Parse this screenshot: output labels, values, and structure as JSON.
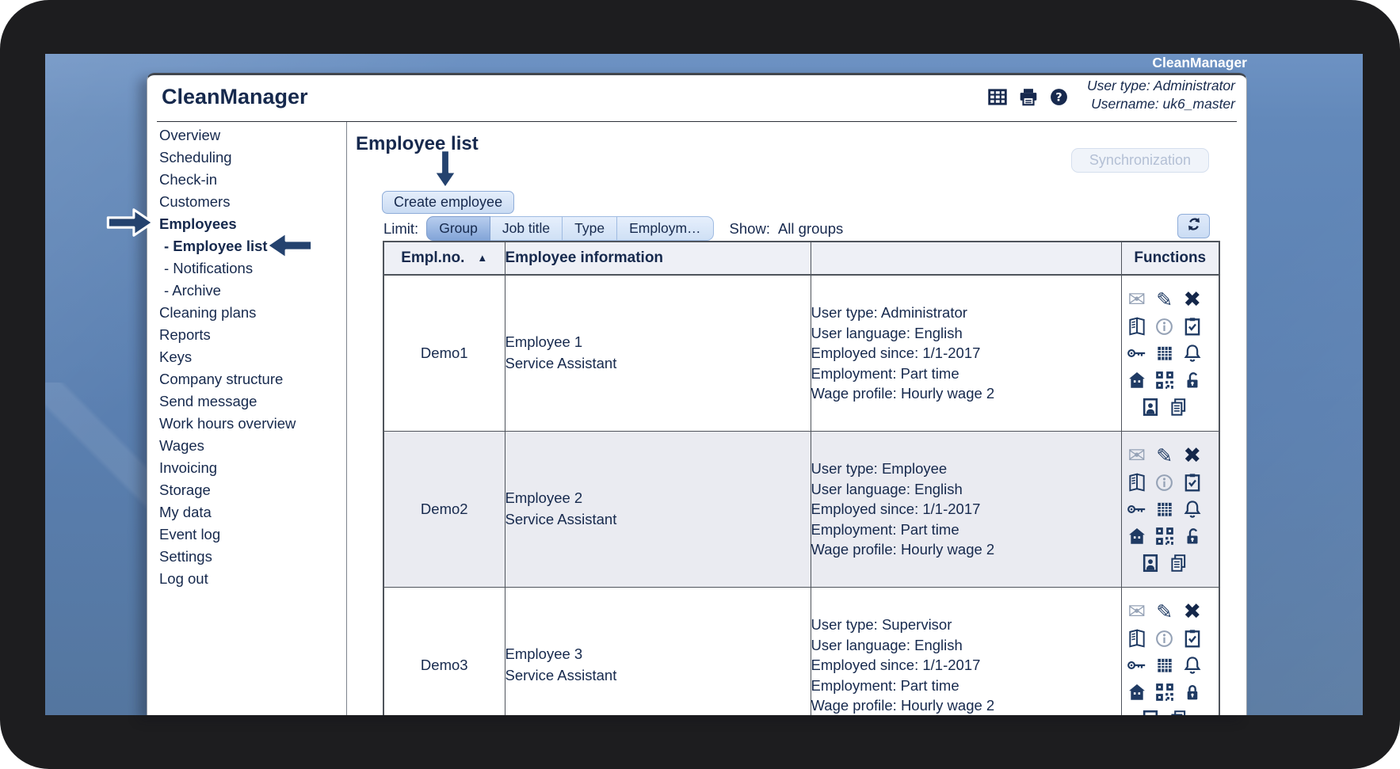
{
  "watermark": "CleanManager",
  "header": {
    "logo": "CleanManager",
    "user_type": "User type: Administrator",
    "username": "Username: uk6_master",
    "icons": [
      "table",
      "printer",
      "help"
    ]
  },
  "sidebar": {
    "items": [
      {
        "label": "Overview"
      },
      {
        "label": "Scheduling"
      },
      {
        "label": "Check-in"
      },
      {
        "label": "Customers"
      },
      {
        "label": "Employees",
        "bold": true
      },
      {
        "label": "Employee list",
        "bold": true,
        "sub": true
      },
      {
        "label": "Notifications",
        "sub": true
      },
      {
        "label": "Archive",
        "sub": true
      },
      {
        "label": "Cleaning plans"
      },
      {
        "label": "Reports"
      },
      {
        "label": "Keys"
      },
      {
        "label": "Company structure"
      },
      {
        "label": "Send message"
      },
      {
        "label": "Work hours overview"
      },
      {
        "label": "Wages"
      },
      {
        "label": "Invoicing"
      },
      {
        "label": "Storage"
      },
      {
        "label": "My data"
      },
      {
        "label": "Event log"
      },
      {
        "label": "Settings"
      },
      {
        "label": "Log out"
      }
    ]
  },
  "main": {
    "title": "Employee list",
    "sync_button": "Synchronization",
    "create_button": "Create employee",
    "limit_label": "Limit:",
    "limit_buttons": [
      {
        "label": "Group",
        "selected": true
      },
      {
        "label": "Job title",
        "selected": false
      },
      {
        "label": "Type",
        "selected": false
      },
      {
        "label": "Employm…",
        "selected": false
      }
    ],
    "show_label": "Show:",
    "show_value": "All groups",
    "table": {
      "headers": [
        "Empl.no.",
        "Employee information",
        "",
        "Functions"
      ],
      "sort_icon": "▲",
      "rows": [
        {
          "empl_no": "Demo1",
          "lines": [
            "Employee 1",
            "Service Assistant"
          ],
          "info": [
            "User type: Administrator",
            "User language: English",
            "Employed since: 1/1-2017",
            "Employment: Part time",
            "Wage profile: Hourly wage 2"
          ],
          "icons": [
            [
              "mail",
              "edit",
              "delete"
            ],
            [
              "book",
              "info",
              "clipboard-check"
            ],
            [
              "key",
              "calendar",
              "bell"
            ],
            [
              "home",
              "qr-code",
              "lock-open"
            ],
            [
              "id-photo",
              "copy-documents"
            ]
          ]
        },
        {
          "empl_no": "Demo2",
          "lines": [
            "Employee 2",
            "Service Assistant"
          ],
          "info": [
            "User type: Employee",
            "User language: English",
            "Employed since: 1/1-2017",
            "Employment: Part time",
            "Wage profile: Hourly wage 2"
          ],
          "icons": [
            [
              "mail",
              "edit",
              "delete"
            ],
            [
              "book",
              "info",
              "clipboard-check"
            ],
            [
              "key",
              "calendar",
              "bell"
            ],
            [
              "home",
              "qr-code",
              "lock-open"
            ],
            [
              "id-photo",
              "copy-documents"
            ]
          ]
        },
        {
          "empl_no": "Demo3",
          "lines": [
            "Employee 3",
            "Service Assistant"
          ],
          "info": [
            "User type: Supervisor",
            "User language: English",
            "Employed since: 1/1-2017",
            "Employment: Part time",
            "Wage profile: Hourly wage 2"
          ],
          "icons": [
            [
              "mail",
              "edit",
              "delete"
            ],
            [
              "book",
              "info",
              "clipboard-check"
            ],
            [
              "key",
              "calendar",
              "bell"
            ],
            [
              "home",
              "qr-code",
              "lock-closed"
            ],
            [
              "id-photo",
              "copy-documents"
            ]
          ]
        }
      ]
    }
  },
  "colors": {
    "text_navy": "#16294d",
    "selected_button_blue": "#83a5d8",
    "alt_row": "#eaebf1",
    "background_blue": "#5a7fb0",
    "frame_black": "#1d1d1f"
  }
}
